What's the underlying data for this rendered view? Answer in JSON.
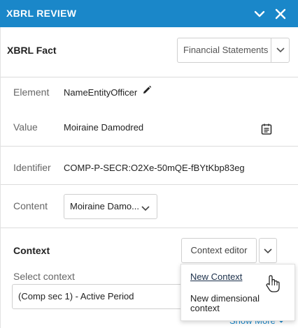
{
  "header": {
    "title": "XBRL REVIEW"
  },
  "section": {
    "title": "XBRL Fact",
    "filter_value": "Financial Statements"
  },
  "fields": {
    "element": {
      "label": "Element",
      "value": "NameEntityOfficer"
    },
    "value": {
      "label": "Value",
      "value": "Moiraine Damodred"
    },
    "identifier": {
      "label": "Identifier",
      "value": "COMP-P-SECR:O2Xe-50mQE-fBYtKbp83eg"
    },
    "content": {
      "label": "Content",
      "selected": "Moiraine Damo..."
    }
  },
  "context": {
    "title": "Context",
    "editor_label": "Context editor",
    "select_label": "Select context",
    "selected": "(Comp sec 1) - Active Period",
    "menu": [
      "New Context",
      "New dimensional context"
    ],
    "show_more": "Show More"
  },
  "colors": {
    "header": "#1a87c9",
    "accent": "#1a87c9"
  }
}
